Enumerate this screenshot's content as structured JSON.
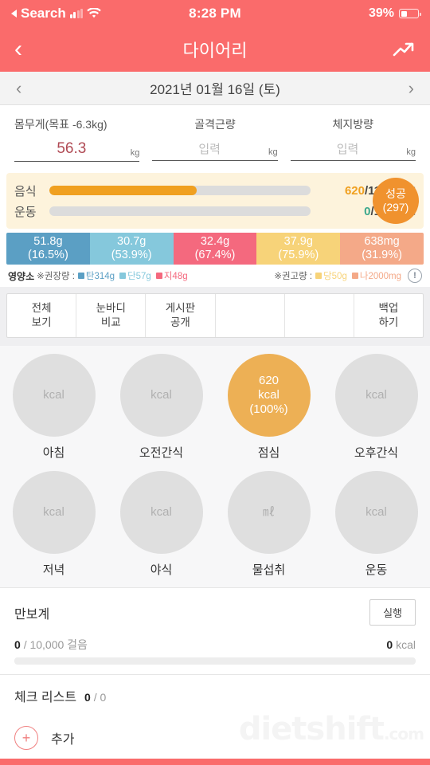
{
  "status_bar": {
    "carrier_label": "Search",
    "time": "8:28 PM",
    "battery_percent": "39%"
  },
  "nav": {
    "title": "다이어리",
    "back_icon": "chevron-left-icon",
    "chart_icon": "trending-up-icon"
  },
  "date_bar": {
    "prev_icon": "chevron-left-icon",
    "next_icon": "chevron-right-icon",
    "date": "2021년 01월 16일 (토)"
  },
  "metrics": [
    {
      "label": "몸무게(목표 -6.3kg)",
      "value": "56.3",
      "placeholder": "입력",
      "unit": "kg",
      "filled": true
    },
    {
      "label": "골격근량",
      "value": "",
      "placeholder": "입력",
      "unit": "kg",
      "filled": false
    },
    {
      "label": "체지방량",
      "value": "",
      "placeholder": "입력",
      "unit": "kg",
      "filled": false
    }
  ],
  "kcal_summary": {
    "food": {
      "label": "음식",
      "current": "620",
      "separator": "/",
      "total": "1100",
      "unit": "kcal",
      "percent": 56.4
    },
    "exercise": {
      "label": "운동",
      "current": "0",
      "separator": "/",
      "total": "183",
      "unit": "kcal",
      "percent": 0
    },
    "badge": {
      "title": "성공",
      "count": "(297)",
      "color": "#F0922E"
    }
  },
  "nutrients": {
    "segments": [
      {
        "amount": "51.8g",
        "percent": "(16.5%)",
        "color": "#5B9FC4"
      },
      {
        "amount": "30.7g",
        "percent": "(53.9%)",
        "color": "#85C8DC"
      },
      {
        "amount": "32.4g",
        "percent": "(67.4%)",
        "color": "#F4697E"
      },
      {
        "amount": "37.9g",
        "percent": "(75.9%)",
        "color": "#F7D379"
      },
      {
        "amount": "638mg",
        "percent": "(31.9%)",
        "color": "#F4A988"
      }
    ],
    "legend_title": "영양소",
    "recommended_label": "※권장량 :",
    "recommended_items": [
      {
        "text": "탄314g",
        "color": "#5B9FC4"
      },
      {
        "text": "단57g",
        "color": "#85C8DC"
      },
      {
        "text": "지48g",
        "color": "#F4697E"
      }
    ],
    "advised_label": "※권고량 :",
    "advised_items": [
      {
        "text": "당50g",
        "color": "#F7D379"
      },
      {
        "text": "나2000mg",
        "color": "#F4A988"
      }
    ],
    "info_icon": "exclamation-circle-icon"
  },
  "action_tabs": [
    {
      "line1": "전체",
      "line2": "보기"
    },
    {
      "line1": "눈바디",
      "line2": "비교"
    },
    {
      "line1": "게시판",
      "line2": "공개"
    },
    {
      "line1": "",
      "line2": ""
    },
    {
      "line1": "",
      "line2": ""
    },
    {
      "line1": "백업",
      "line2": "하기"
    }
  ],
  "meals": {
    "row1": [
      {
        "name": "아침",
        "value": "",
        "unit": "kcal",
        "percent": "",
        "filled": false
      },
      {
        "name": "오전간식",
        "value": "",
        "unit": "kcal",
        "percent": "",
        "filled": false
      },
      {
        "name": "점심",
        "value": "620",
        "unit": "kcal",
        "percent": "(100%)",
        "filled": true
      },
      {
        "name": "오후간식",
        "value": "",
        "unit": "kcal",
        "percent": "",
        "filled": false
      }
    ],
    "row2": [
      {
        "name": "저녁",
        "value": "",
        "unit": "kcal",
        "percent": "",
        "filled": false
      },
      {
        "name": "야식",
        "value": "",
        "unit": "kcal",
        "percent": "",
        "filled": false
      },
      {
        "name": "물섭취",
        "value": "",
        "unit": "㎖",
        "percent": "",
        "filled": false
      },
      {
        "name": "운동",
        "value": "",
        "unit": "kcal",
        "percent": "",
        "filled": false
      }
    ]
  },
  "pedometer": {
    "title": "만보계",
    "run_button": "실행",
    "steps_current": "0",
    "steps_divider": "/ 10,000 걸음",
    "kcal_value": "0",
    "kcal_unit": "kcal",
    "percent": 0
  },
  "checklist": {
    "title": "체크 리스트",
    "done": "0",
    "total": "/ 0",
    "add_label": "추가",
    "add_icon": "plus-circle-icon"
  },
  "watermark": {
    "text": "dietshift",
    "suffix": ".com"
  }
}
